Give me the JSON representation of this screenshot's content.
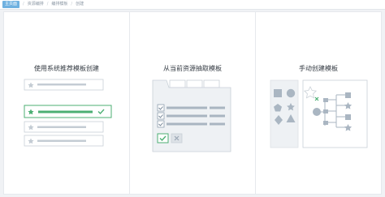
{
  "breadcrumb": {
    "home": "主页面",
    "items": [
      "资源编排",
      "编排模板",
      "创建"
    ]
  },
  "cards": [
    {
      "title": "使用系统推荐模板创建"
    },
    {
      "title": "从当前资源抽取模板"
    },
    {
      "title": "手动创建模板"
    }
  ],
  "colors": {
    "accent_green": "#4caf73",
    "breadcrumb_home_bg": "#6fb1e0",
    "illustration_gray": "#b8c2cc",
    "illustration_light": "#eef1f4"
  }
}
